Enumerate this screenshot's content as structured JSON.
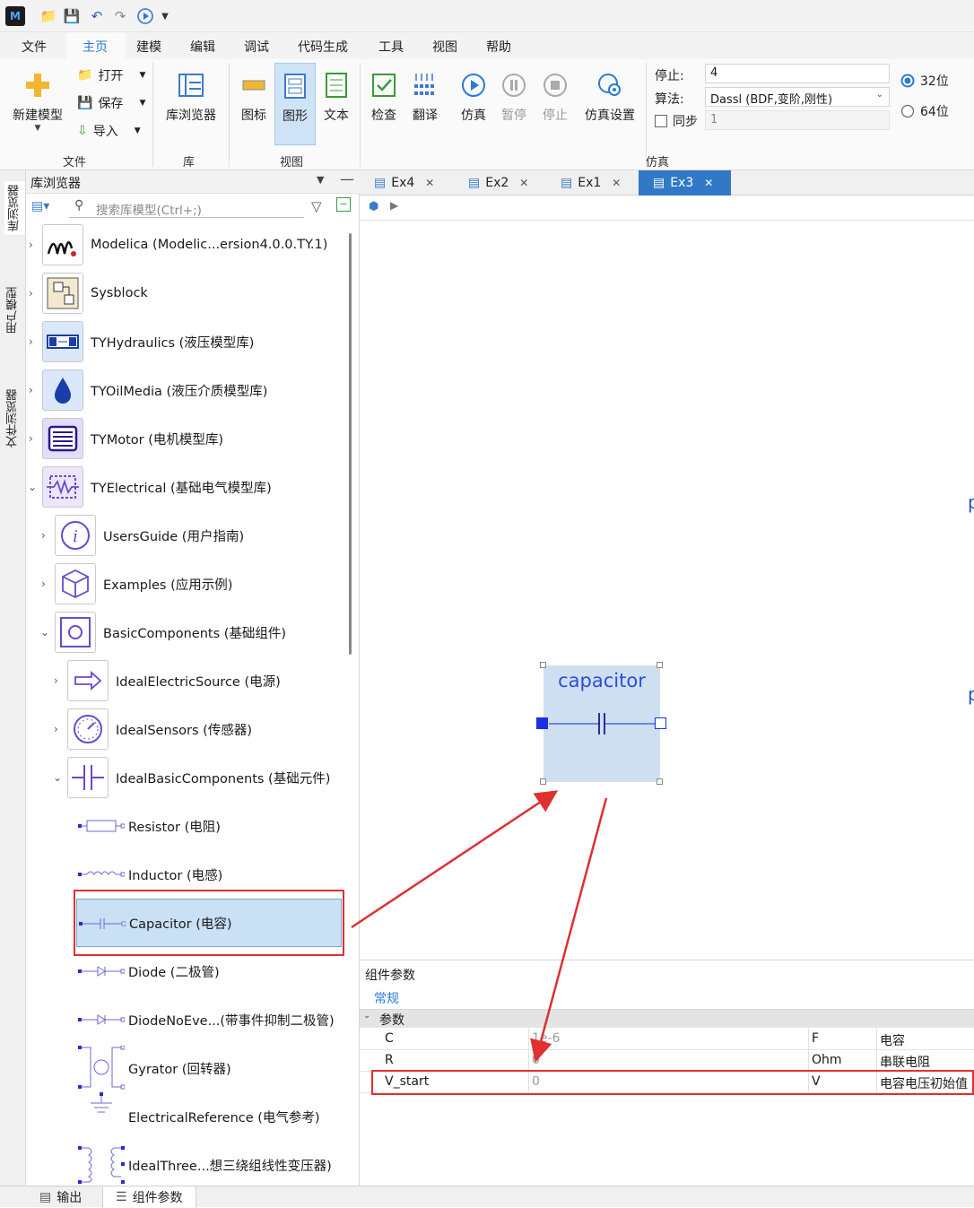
{
  "menu": [
    "文件",
    "主页",
    "建模",
    "编辑",
    "调试",
    "代码生成",
    "工具",
    "视图",
    "帮助"
  ],
  "ribbon": {
    "new_model": "新建模型",
    "open": "打开",
    "save": "保存",
    "import": "导入",
    "lib_browser": "库浏览器",
    "icon": "图标",
    "graphic": "图形",
    "text": "文本",
    "check": "检查",
    "translate": "翻译",
    "simulate": "仿真",
    "pause": "暂停",
    "stop": "停止",
    "sim_settings": "仿真设置",
    "stop_label": "停止:",
    "stop_value": "4",
    "algo_label": "算法:",
    "algo_value": "Dassl (BDF,变阶,刚性)",
    "sync_label": "同步",
    "sync_value": "1",
    "bit32": "32位",
    "bit64": "64位",
    "groups": {
      "file": "文件",
      "lib": "库",
      "view": "视图",
      "sim": "仿真"
    }
  },
  "side_tabs": [
    "库浏览器",
    "用户模型",
    "文件浏览器"
  ],
  "browser": {
    "title": "库浏览器",
    "search_placeholder": "搜索库模型(Ctrl+;)",
    "items": [
      {
        "label": "Modelica (Modelic...ersion4.0.0.TY.1)"
      },
      {
        "label": "Sysblock"
      },
      {
        "label": "TYHydraulics (液压模型库)"
      },
      {
        "label": "TYOilMedia (液压介质模型库)"
      },
      {
        "label": "TYMotor (电机模型库)"
      },
      {
        "label": "TYElectrical (基础电气模型库)"
      },
      {
        "label": "UsersGuide (用户指南)"
      },
      {
        "label": "Examples (应用示例)"
      },
      {
        "label": "BasicComponents (基础组件)"
      },
      {
        "label": "IdealElectricSource (电源)"
      },
      {
        "label": "IdealSensors (传感器)"
      },
      {
        "label": "IdealBasicComponents (基础元件)"
      },
      {
        "label": "Resistor (电阻)"
      },
      {
        "label": "Inductor (电感)"
      },
      {
        "label": "Capacitor (电容)"
      },
      {
        "label": "Diode (二极管)"
      },
      {
        "label": "DiodeNoEve...(带事件抑制二极管)"
      },
      {
        "label": "Gyrator (回转器)"
      },
      {
        "label": "ElectricalReference (电气参考)"
      },
      {
        "label": "IdealThree...想三绕组线性变压器)"
      }
    ]
  },
  "doc_tabs": [
    "Ex4",
    "Ex2",
    "Ex1",
    "Ex3"
  ],
  "canvas": {
    "component_name": "capacitor",
    "edge_text_1": "p",
    "edge_text_2": "p"
  },
  "params": {
    "title": "组件参数",
    "tab_general": "常规",
    "section": "参数",
    "rows": [
      {
        "name": "C",
        "value": "1e-6",
        "unit": "F",
        "desc": "电容"
      },
      {
        "name": "R",
        "value": "0",
        "unit": "Ohm",
        "desc": "串联电阻"
      },
      {
        "name": "V_start",
        "value": "0",
        "unit": "V",
        "desc": "电容电压初始值"
      }
    ]
  },
  "status": {
    "output": "输出",
    "comp_params": "组件参数"
  }
}
